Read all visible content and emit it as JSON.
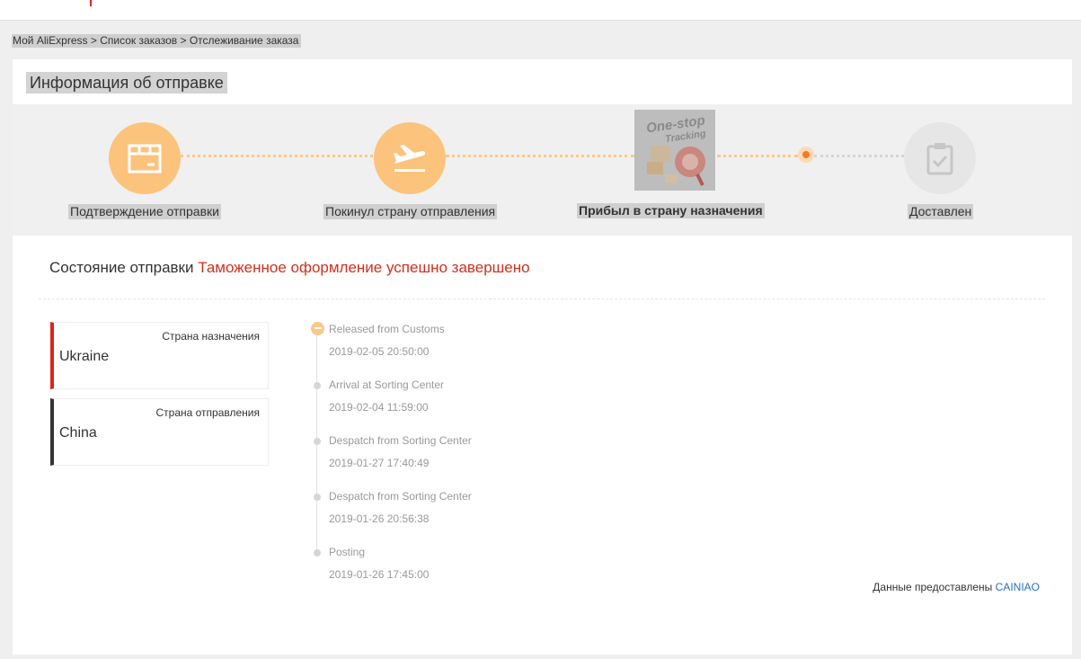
{
  "breadcrumb": {
    "item1": "Мой AliExpress",
    "sep": ">",
    "item2": "Список заказов",
    "item3": "Отслеживание заказа"
  },
  "card": {
    "title": "Информация об отправке"
  },
  "steps": [
    {
      "label": "Подтверждение отправки",
      "icon": "package-icon",
      "state": "done"
    },
    {
      "label": "Покинул страну отправления",
      "icon": "airplane-takeoff-icon",
      "state": "done"
    },
    {
      "label": "Прибыл в страну назначения",
      "icon": "one-stop-tracking-logo",
      "state": "current"
    },
    {
      "label": "Доставлен",
      "icon": "clipboard-check-icon",
      "state": "pending"
    }
  ],
  "logo": {
    "line1": "One-stop",
    "line2": "Tracking"
  },
  "status": {
    "label": "Состояние отправки",
    "value": "Таможенное оформление успешно завершено"
  },
  "destination": {
    "caption": "Страна назначения",
    "country": "Ukraine"
  },
  "origin": {
    "caption": "Страна отправления",
    "country": "China"
  },
  "timeline": [
    {
      "event": "Released from Customs",
      "time": "2019-02-05 20:50:00"
    },
    {
      "event": "Arrival at Sorting Center",
      "time": "2019-02-04 11:59:00"
    },
    {
      "event": "Despatch from Sorting Center",
      "time": "2019-01-27 17:40:49"
    },
    {
      "event": "Despatch from Sorting Center",
      "time": "2019-01-26 20:56:38"
    },
    {
      "event": "Posting",
      "time": "2019-01-26 17:45:00"
    }
  ],
  "provider": {
    "label": "Данные предоставлены",
    "link": "CAINIAO"
  },
  "colors": {
    "accent_orange": "#fcc37c",
    "status_red": "#d0301c",
    "link_blue": "#2a6fbf"
  }
}
